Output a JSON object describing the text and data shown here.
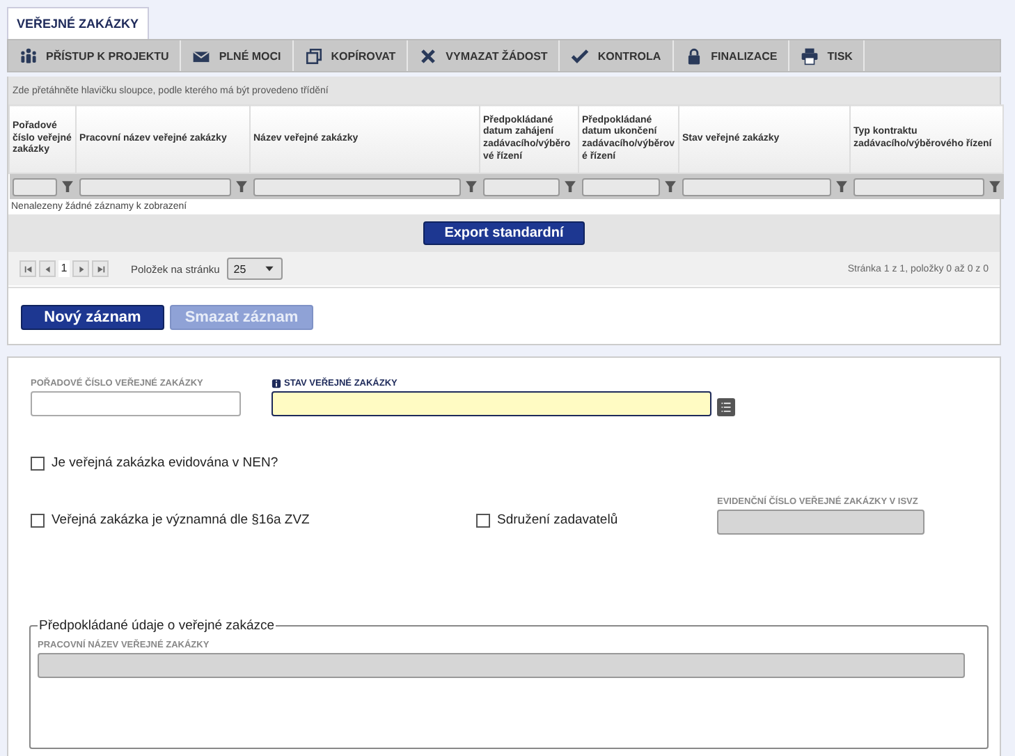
{
  "tab": {
    "label": "VEŘEJNÉ ZAKÁZKY",
    "selected": true
  },
  "toolbar": [
    {
      "label": "PŘÍSTUP K PROJEKTU"
    },
    {
      "label": "PLNÉ MOCI"
    },
    {
      "label": "KOPÍROVAT"
    },
    {
      "label": "VYMAZAT ŽÁDOST"
    },
    {
      "label": "KONTROLA"
    },
    {
      "label": "FINALIZACE"
    },
    {
      "label": "TISK"
    }
  ],
  "grid": {
    "group_hint": "Zde přetáhněte hlavičku sloupce, podle kterého má být provedeno třídění",
    "columns": [
      "Pořadové číslo veřejné zakázky",
      "Pracovní název veřejné zakázky",
      "Název veřejné zakázky",
      "Předpokládané datum zahájení zadávacího/výběrové řízení",
      "Předpokládané datum ukončení zadávacího/výběrové řízení",
      "Stav veřejné zakázky",
      "Typ kontraktu zadávacího/výběrového řízení"
    ],
    "empty_message": "Nenalezeny žádné záznamy k zobrazení",
    "export_button": "Export standardní",
    "pager": {
      "page": "1",
      "page_size_label": "Položek na stránku",
      "page_size": "25",
      "summary": "Stránka 1 z 1, položky 0 až 0 z 0"
    }
  },
  "buttons": [
    {
      "label": "Nový záznam",
      "disabled": false
    },
    {
      "label": "Smazat záznam",
      "disabled": true
    }
  ],
  "form": {
    "fields": [
      {
        "label": "POŘADOVÉ ČÍSLO VEŘEJNÉ ZAKÁZKY",
        "disabled": false,
        "highlighted": false
      },
      {
        "label": "STAV VEŘEJNÉ ZAKÁZKY",
        "required": true,
        "disabled": false,
        "highlighted": true
      }
    ],
    "checkbox_nen": {
      "label": "Je veřejná zakázka evidována v NEN?",
      "checked": false
    },
    "checkbox_significant": {
      "label": "Veřejná zakázka je významná dle §16a ZVZ",
      "checked": false
    },
    "checkbox_association": {
      "label": "Sdružení zadavatelů",
      "checked": false
    },
    "isvz_field": {
      "label": "EVIDENČNÍ ČÍSLO VEŘEJNÉ ZAKÁZKY V ISVZ",
      "disabled": true
    },
    "fieldset": {
      "legend": "Předpokládané údaje o veřejné zakázce",
      "field": {
        "label": "PRACOVNÍ NÁZEV VEŘEJNÉ ZAKÁZKY",
        "disabled": true
      }
    }
  }
}
